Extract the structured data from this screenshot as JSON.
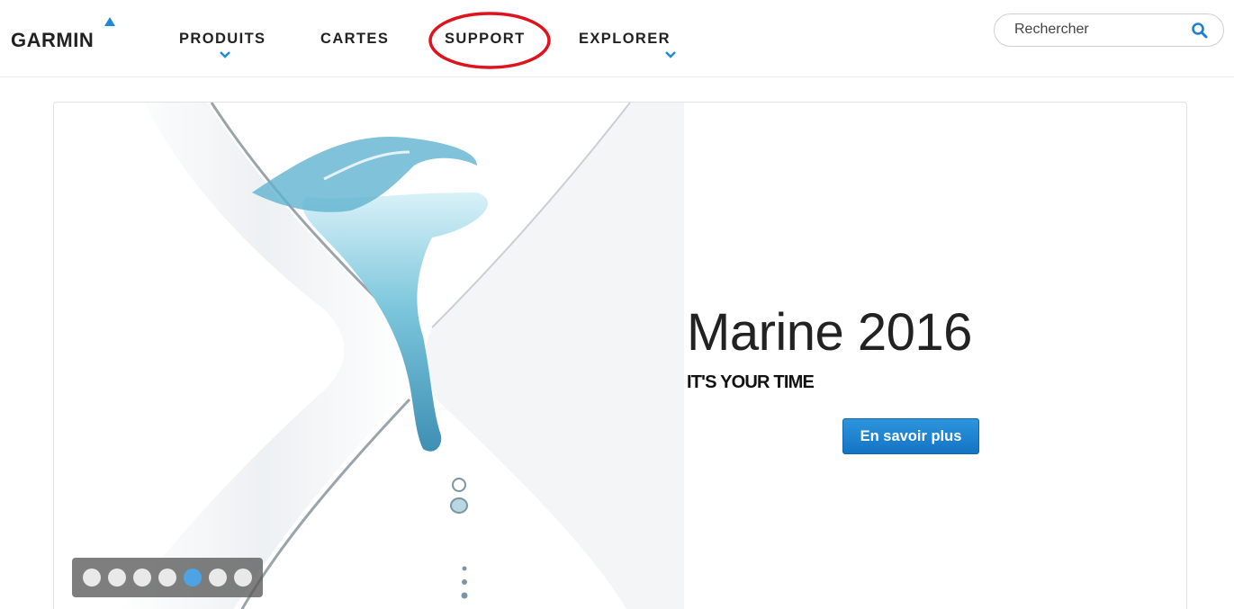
{
  "header": {
    "logo_text": "GARMIN",
    "nav": [
      {
        "label": "PRODUITS",
        "has_dropdown": true
      },
      {
        "label": "CARTES",
        "has_dropdown": false
      },
      {
        "label": "SUPPORT",
        "has_dropdown": false,
        "highlighted": true
      },
      {
        "label": "EXPLORER",
        "has_dropdown": true
      }
    ],
    "search": {
      "placeholder": "Rechercher",
      "icon": "search-icon"
    }
  },
  "hero": {
    "title": "Marine 2016",
    "subtitle": "IT'S YOUR TIME",
    "cta_label": "En savoir plus",
    "carousel": {
      "total": 7,
      "active_index": 4
    }
  },
  "colors": {
    "accent": "#1e8ad6",
    "button": "#1a7fce",
    "highlight_ring": "#e0121b",
    "active_dot": "#4ea3e3"
  }
}
